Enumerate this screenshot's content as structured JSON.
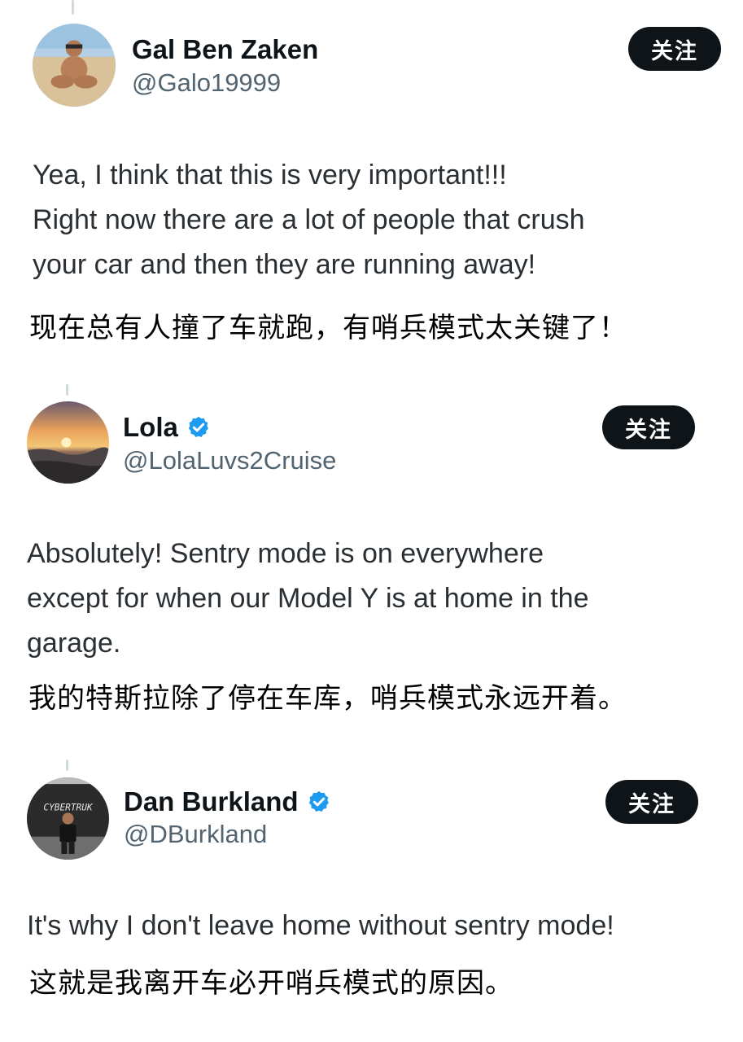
{
  "tweets": [
    {
      "name": "Gal Ben Zaken",
      "handle": "@Galo19999",
      "verified": false,
      "follow_label": "关注",
      "text_lines": [
        "Yea, I think that this is very important!!!",
        "Right now there are a lot of people that crush",
        "your car and then they are running away!"
      ],
      "translation": "现在总有人撞了车就跑，有哨兵模式太关键了！"
    },
    {
      "name": "Lola",
      "handle": "@LolaLuvs2Cruise",
      "verified": true,
      "follow_label": "关注",
      "text_lines": [
        "Absolutely! Sentry mode is on everywhere",
        "except for when our Model Y is at home in the",
        "garage."
      ],
      "translation": "我的特斯拉除了停在车库，哨兵模式永远开着。"
    },
    {
      "name": "Dan Burkland",
      "handle": "@DBurkland",
      "verified": true,
      "follow_label": "关注",
      "text_lines": [
        "It's why I don't leave home without sentry mode!"
      ],
      "translation": "这就是我离开车必开哨兵模式的原因。"
    }
  ],
  "colors": {
    "text": "#0f1419",
    "handle": "#536471",
    "button_bg": "#0f1419",
    "button_text": "#ffffff",
    "verified": "#1d9bf0"
  },
  "icons": {
    "verified": "verified-badge-icon"
  }
}
